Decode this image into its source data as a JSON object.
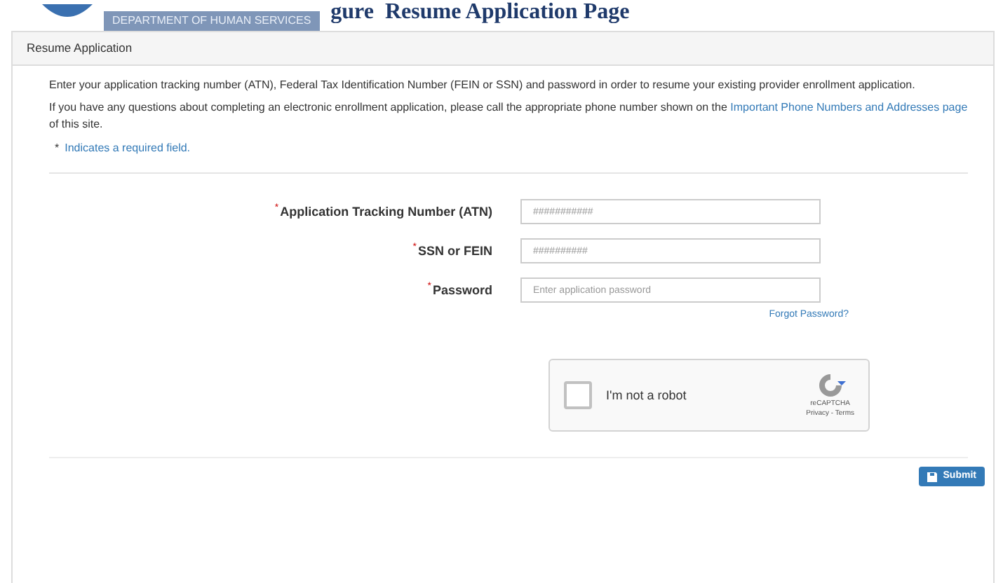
{
  "header": {
    "agency": "DEPARTMENT OF HUMAN SERVICES",
    "caption_start": "gure",
    "caption_end": "Resume Application Page"
  },
  "panel": {
    "title": "Resume Application",
    "intro": "Enter your application tracking number (ATN), Federal Tax Identification Number (FEIN or SSN) and password in order to resume your existing provider enrollment application.",
    "help_before": "If you have any questions about completing an electronic enrollment application, please call the appropriate phone number shown on the",
    "help_link": "Important Phone Numbers and Addresses page",
    "help_after": "of this site.",
    "required_mark": "*",
    "required_note": "Indicates a required field."
  },
  "fields": [
    {
      "label": "Application Tracking Number (ATN)",
      "required": true,
      "placeholder": "###########"
    },
    {
      "label": "SSN or FEIN",
      "required": true,
      "placeholder": "##########"
    },
    {
      "label": "Password",
      "required": true,
      "placeholder": "Enter application password",
      "link": "Forgot Password?"
    }
  ],
  "captcha": {
    "label": "I'm not a robot",
    "checked": false,
    "brand": "reCAPTCHA",
    "links": "Privacy - Terms"
  },
  "submit": {
    "label": "Submit"
  }
}
